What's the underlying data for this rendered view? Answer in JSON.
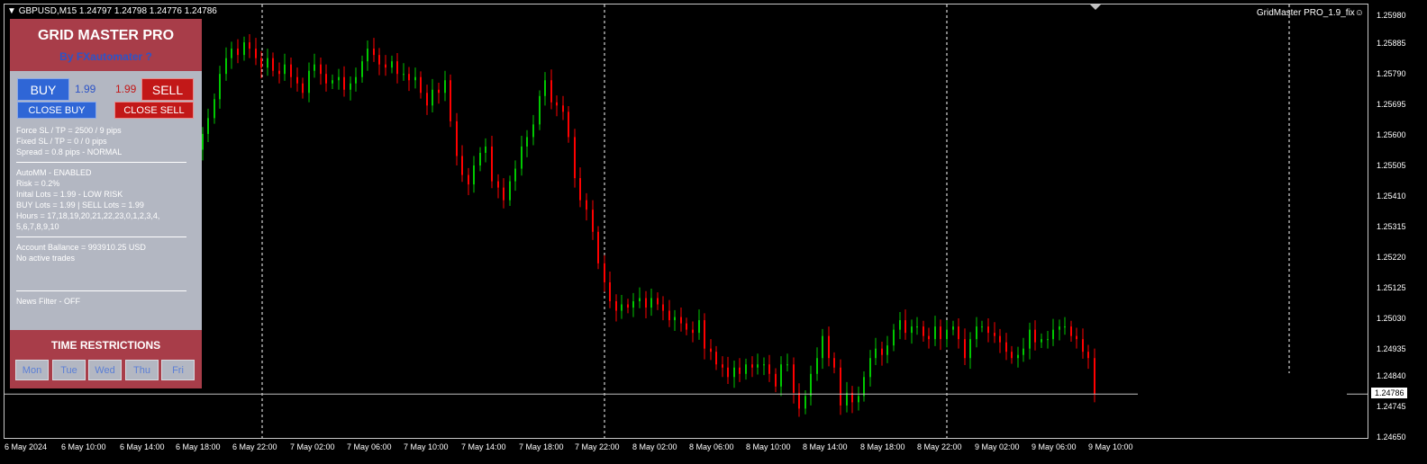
{
  "header": {
    "symbol_line": "GBPUSD,M15  1.24797 1.24798 1.24776 1.24786",
    "indicator_name": "GridMaster PRO_1.9_fix☺"
  },
  "panel": {
    "title": "GRID MASTER PRO",
    "subtitle": "By FXautomater ?",
    "buy_label": "BUY",
    "sell_label": "SELL",
    "buy_lots": "1.99",
    "sell_lots": "1.99",
    "close_buy_label": "CLOSE BUY",
    "close_sell_label": "CLOSE SELL",
    "info_lines": [
      "Force SL / TP = 2500 / 9 pips",
      "Fixed SL / TP = 0 / 0 pips",
      "Spread = 0.8 pips - NORMAL",
      "AutoMM - ENABLED",
      "Risk = 0.2%",
      "Inital Lots = 1.99 - LOW RISK",
      "BUY Lots = 1.99 | SELL Lots = 1.99",
      "Hours = 17,18,19,20,21,22,23,0,1,2,3,4,",
      "5,6,7,8,9,10",
      "Account Ballance = 993910.25 USD",
      "No active trades",
      "News Filter - OFF"
    ],
    "time_restrictions_title": "TIME RESTRICTIONS",
    "days": [
      "Mon",
      "Tue",
      "Wed",
      "Thu",
      "Fri"
    ]
  },
  "price_axis": [
    "1.25980",
    "1.25885",
    "1.25790",
    "1.25695",
    "1.25600",
    "1.25505",
    "1.25410",
    "1.25315",
    "1.25220",
    "1.25125",
    "1.25030",
    "1.24935",
    "1.24840",
    "1.24745",
    "1.24650"
  ],
  "current_price": "1.24786",
  "time_axis": [
    "6 May 2024",
    "6 May 10:00",
    "6 May 14:00",
    "6 May 18:00",
    "6 May 22:00",
    "7 May 02:00",
    "7 May 06:00",
    "7 May 10:00",
    "7 May 14:00",
    "7 May 18:00",
    "7 May 22:00",
    "8 May 02:00",
    "8 May 06:00",
    "8 May 10:00",
    "8 May 14:00",
    "8 May 18:00",
    "8 May 22:00",
    "9 May 02:00",
    "9 May 06:00",
    "9 May 10:00"
  ],
  "colors": {
    "bull_candle": "#00c800",
    "bear_candle": "#ff0000",
    "panel_bg": "#b3b7c2",
    "panel_header": "#a83d49"
  },
  "chart_data": {
    "type": "line",
    "series": [
      {
        "values": [
          1.256,
          1.2559,
          1.2556,
          1.2561,
          1.2566,
          1.2572,
          1.258,
          1.2585,
          1.2588,
          1.2586,
          1.259,
          1.2588,
          1.2585,
          1.2582,
          1.2585,
          1.2581,
          1.258,
          1.2583,
          1.2579,
          1.2577,
          1.2574,
          1.2581,
          1.2583,
          1.258,
          1.2577,
          1.2578,
          1.2579,
          1.2575,
          1.2577,
          1.2579,
          1.2584,
          1.2588,
          1.2586,
          1.2583,
          1.2582,
          1.2584,
          1.258,
          1.258,
          1.2578,
          1.2579,
          1.2574,
          1.257,
          1.2575,
          1.2574,
          1.2578,
          1.2565,
          1.2554,
          1.2548,
          1.2545,
          1.2551,
          1.2555,
          1.2557,
          1.2546,
          1.2544,
          1.254,
          1.2546,
          1.255,
          1.2557,
          1.256,
          1.2564,
          1.2573,
          1.2578,
          1.2571,
          1.257,
          1.2568,
          1.256,
          1.2547,
          1.254,
          1.2537,
          1.253,
          1.252,
          1.2514,
          1.2508,
          1.2505,
          1.2507,
          1.2506,
          1.2508,
          1.2509,
          1.2506,
          1.2509,
          1.2507,
          1.2505,
          1.2502,
          1.2503,
          1.2501,
          1.2499,
          1.2498,
          1.2502,
          1.2493,
          1.2492,
          1.2488,
          1.2487,
          1.2484,
          1.2487,
          1.2485,
          1.2488,
          1.2487,
          1.2488,
          1.2488,
          1.2485,
          1.2481,
          1.2488,
          1.2488,
          1.2479,
          1.2474,
          1.2478,
          1.2485,
          1.249,
          1.2497,
          1.249,
          1.2487,
          1.2475,
          1.2479,
          1.2476,
          1.2478,
          1.2484,
          1.249,
          1.2493,
          1.2491,
          1.2494,
          1.2499,
          1.2502,
          1.2498,
          1.25,
          1.25,
          1.2497,
          1.2496,
          1.25,
          1.2496,
          1.2499,
          1.25,
          1.2496,
          1.249,
          1.2496,
          1.25,
          1.25,
          1.2498,
          1.2497,
          1.2495,
          1.2492,
          1.249,
          1.2491,
          1.2493,
          1.2499,
          1.2495,
          1.2496,
          1.2496,
          1.2499,
          1.25,
          1.25,
          1.2497,
          1.2496,
          1.2492,
          1.249,
          1.24786
        ]
      }
    ]
  }
}
